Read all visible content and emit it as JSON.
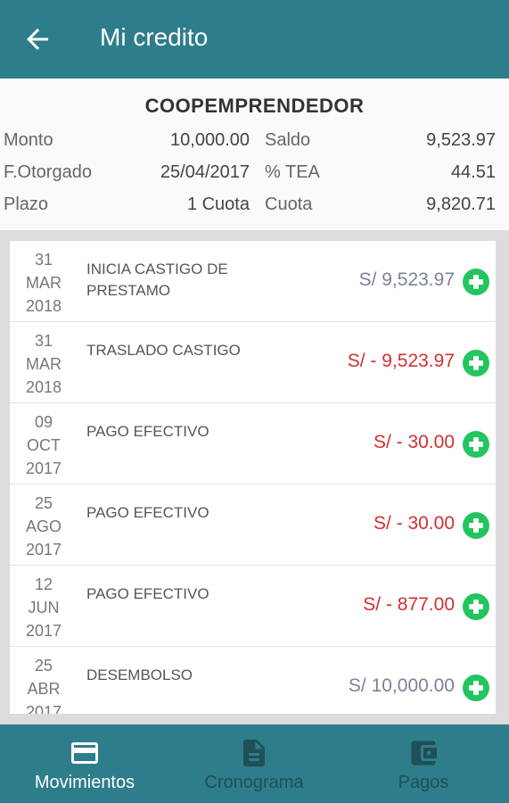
{
  "header": {
    "title": "Mi credito"
  },
  "summary": {
    "product": "COOPEMPRENDEDOR",
    "rows": [
      {
        "l1": "Monto",
        "v1": "10,000.00",
        "l2": "Saldo",
        "v2": "9,523.97"
      },
      {
        "l1": "F.Otorgado",
        "v1": "25/04/2017",
        "l2": "% TEA",
        "v2": "44.51"
      },
      {
        "l1": "Plazo",
        "v1": "1 Cuota",
        "l2": "Cuota",
        "v2": "9,820.71"
      }
    ]
  },
  "movements": [
    {
      "day": "31",
      "month": "MAR",
      "year": "2018",
      "desc": "INICIA CASTIGO DE PRESTAMO",
      "amount": "S/  9,523.97"
    },
    {
      "day": "31",
      "month": "MAR",
      "year": "2018",
      "desc": "TRASLADO CASTIGO",
      "amount": "S/ - 9,523.97"
    },
    {
      "day": "09",
      "month": "OCT",
      "year": "2017",
      "desc": "PAGO EFECTIVO",
      "amount": "S/ - 30.00"
    },
    {
      "day": "25",
      "month": "AGO",
      "year": "2017",
      "desc": "PAGO EFECTIVO",
      "amount": "S/ - 30.00"
    },
    {
      "day": "12",
      "month": "JUN",
      "year": "2017",
      "desc": "PAGO EFECTIVO",
      "amount": "S/ - 877.00"
    },
    {
      "day": "25",
      "month": "ABR",
      "year": "2017",
      "desc": "DESEMBOLSO",
      "amount": "S/  10,000.00"
    }
  ],
  "bottom_nav": {
    "tabs": [
      {
        "label": "Movimientos",
        "icon": "credit-card-icon"
      },
      {
        "label": "Cronograma",
        "icon": "document-icon"
      },
      {
        "label": "Pagos",
        "icon": "wallet-icon"
      }
    ]
  },
  "colors": {
    "primary": "#2e7d8b",
    "negative": "#d32f2f",
    "positive": "#7a8396",
    "add": "#22c55e"
  }
}
